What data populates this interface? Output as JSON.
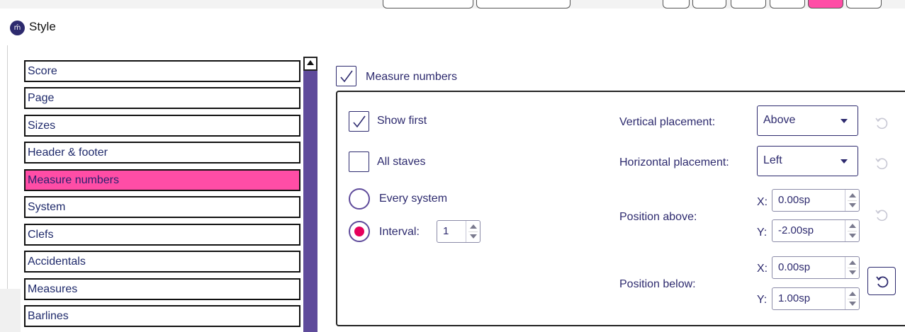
{
  "window": {
    "title": "Style",
    "app_icon_glyph": "ḿ"
  },
  "categories": [
    {
      "label": "Score"
    },
    {
      "label": "Page"
    },
    {
      "label": "Sizes"
    },
    {
      "label": "Header & footer"
    },
    {
      "label": "Measure numbers",
      "selected": true
    },
    {
      "label": "System"
    },
    {
      "label": "Clefs"
    },
    {
      "label": "Accidentals"
    },
    {
      "label": "Measures"
    },
    {
      "label": "Barlines"
    }
  ],
  "measure_numbers": {
    "enable_label": "Measure numbers",
    "enabled": true,
    "show_first_label": "Show first",
    "show_first": true,
    "all_staves_label": "All staves",
    "all_staves": false,
    "every_system_label": "Every system",
    "interval_label": "Interval:",
    "interval_value": "1",
    "interval_selected": true,
    "vertical_placement_label": "Vertical placement:",
    "vertical_placement_value": "Above",
    "horizontal_placement_label": "Horizontal placement:",
    "horizontal_placement_value": "Left",
    "position_above_label": "Position above:",
    "position_above_x_label": "X:",
    "position_above_x": "0.00sp",
    "position_above_y_label": "Y:",
    "position_above_y": "-2.00sp",
    "position_below_label": "Position below:",
    "position_below_x_label": "X:",
    "position_below_x": "0.00sp",
    "position_below_y_label": "Y:",
    "position_below_y": "1.00sp"
  },
  "colors": {
    "accent": "#2d2a6e",
    "selection": "#ff4da6",
    "scrollbar": "#5f4b9b",
    "radio_fill": "#e6005c"
  },
  "icons": {
    "check": "check-icon",
    "reset": "reset-icon",
    "dropdown": "chevron-down-icon"
  }
}
